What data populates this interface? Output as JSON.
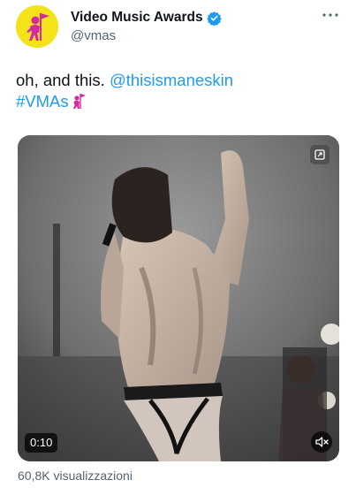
{
  "account": {
    "display_name": "Video Music Awards",
    "handle": "@vmas",
    "verified": true,
    "avatar_icon": "vma-astronaut-flag-icon",
    "avatar_bg": "#f4e31a"
  },
  "tweet": {
    "text_lead": "oh, and this. ",
    "mention": "@thisismaneskin",
    "hashtag": "#VMAs",
    "hashtag_emoji": "vma-astronaut-flag-icon",
    "link_color": "#1d9bf0"
  },
  "media": {
    "type": "video",
    "elapsed": "0:10",
    "expand_icon": "expand-icon",
    "mute_icon": "speaker-muted-icon"
  },
  "stats": {
    "views": "60,8K visualizzazioni"
  },
  "menu": {
    "icon": "more-options-icon"
  }
}
